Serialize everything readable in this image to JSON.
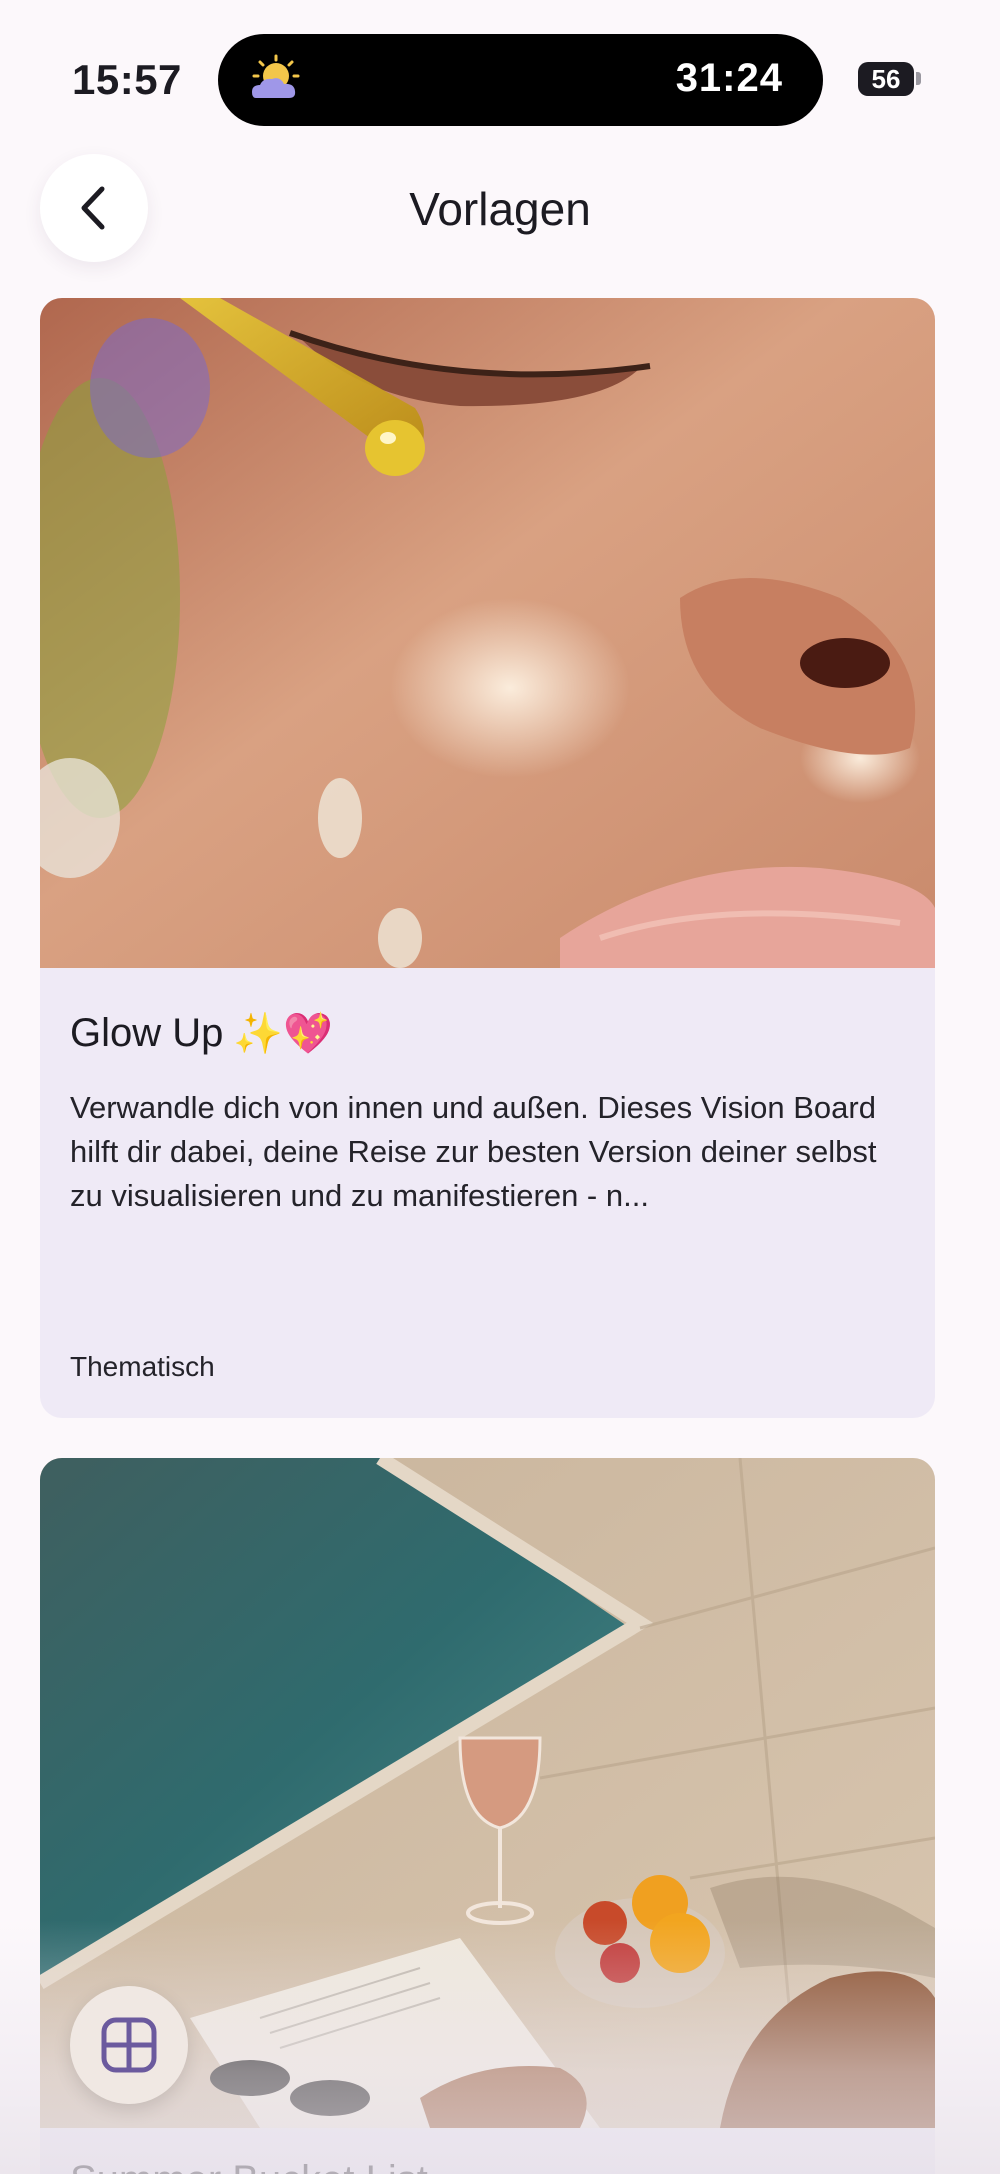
{
  "status_bar": {
    "time": "15:57",
    "timer": "31:24",
    "battery": "56"
  },
  "header": {
    "title": "Vorlagen",
    "back_icon": "chevron-left-icon"
  },
  "templates": [
    {
      "title": "Glow Up",
      "title_emoji": "✨💖",
      "description": "Verwandle dich von innen und außen. Dieses Vision Board hilft dir dabei, deine Reise zur besten Version deiner selbst zu visualisieren und zu manifestieren - n...",
      "category": "Thematisch"
    },
    {
      "title": "Summer Bucket List"
    }
  ],
  "fab": {
    "icon": "layout-grid-icon"
  },
  "colors": {
    "background": "#fcf8fb",
    "card_background": "#efeaf6",
    "accent": "#6b5a9e"
  }
}
